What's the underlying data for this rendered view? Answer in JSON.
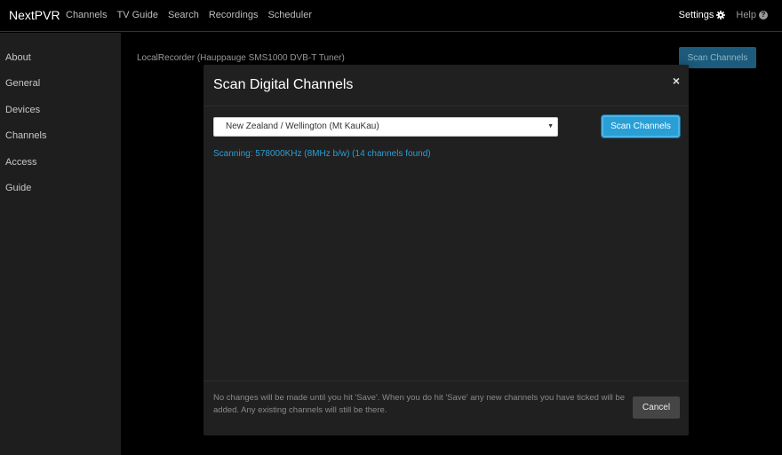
{
  "navbar": {
    "brand": "NextPVR",
    "links": [
      "Channels",
      "TV Guide",
      "Search",
      "Recordings",
      "Scheduler"
    ],
    "settings_label": "Settings",
    "help_label": "Help"
  },
  "sidebar": {
    "items": [
      {
        "label": "About"
      },
      {
        "label": "General"
      },
      {
        "label": "Devices"
      },
      {
        "label": "Channels"
      },
      {
        "label": "Access"
      },
      {
        "label": "Guide"
      }
    ]
  },
  "background": {
    "tuner_label": "LocalRecorder (Hauppauge SMS1000 DVB-T Tuner)",
    "scan_button_label": "Scan Channels"
  },
  "modal": {
    "title": "Scan Digital Channels",
    "close_glyph": "×",
    "region_selected": "New Zealand / Wellington (Mt KauKau)",
    "scan_button_label": "Scan Channels",
    "status_text": "Scanning: 578000KHz (8MHz b/w) (14 channels found)",
    "footer_note": "No changes will be made until you hit 'Save'. When you do hit 'Save' any new channels you have ticked will be added. Any existing channels will still be there.",
    "cancel_label": "Cancel"
  },
  "colors": {
    "accent": "#2a9fd6",
    "background": "#000000",
    "sidebar": "#1e1e1e",
    "modal": "#202020"
  },
  "icons": {
    "settings": "gear-icon",
    "help": "question-circle-icon",
    "close": "close-icon",
    "dropdown": "caret-down-icon"
  }
}
